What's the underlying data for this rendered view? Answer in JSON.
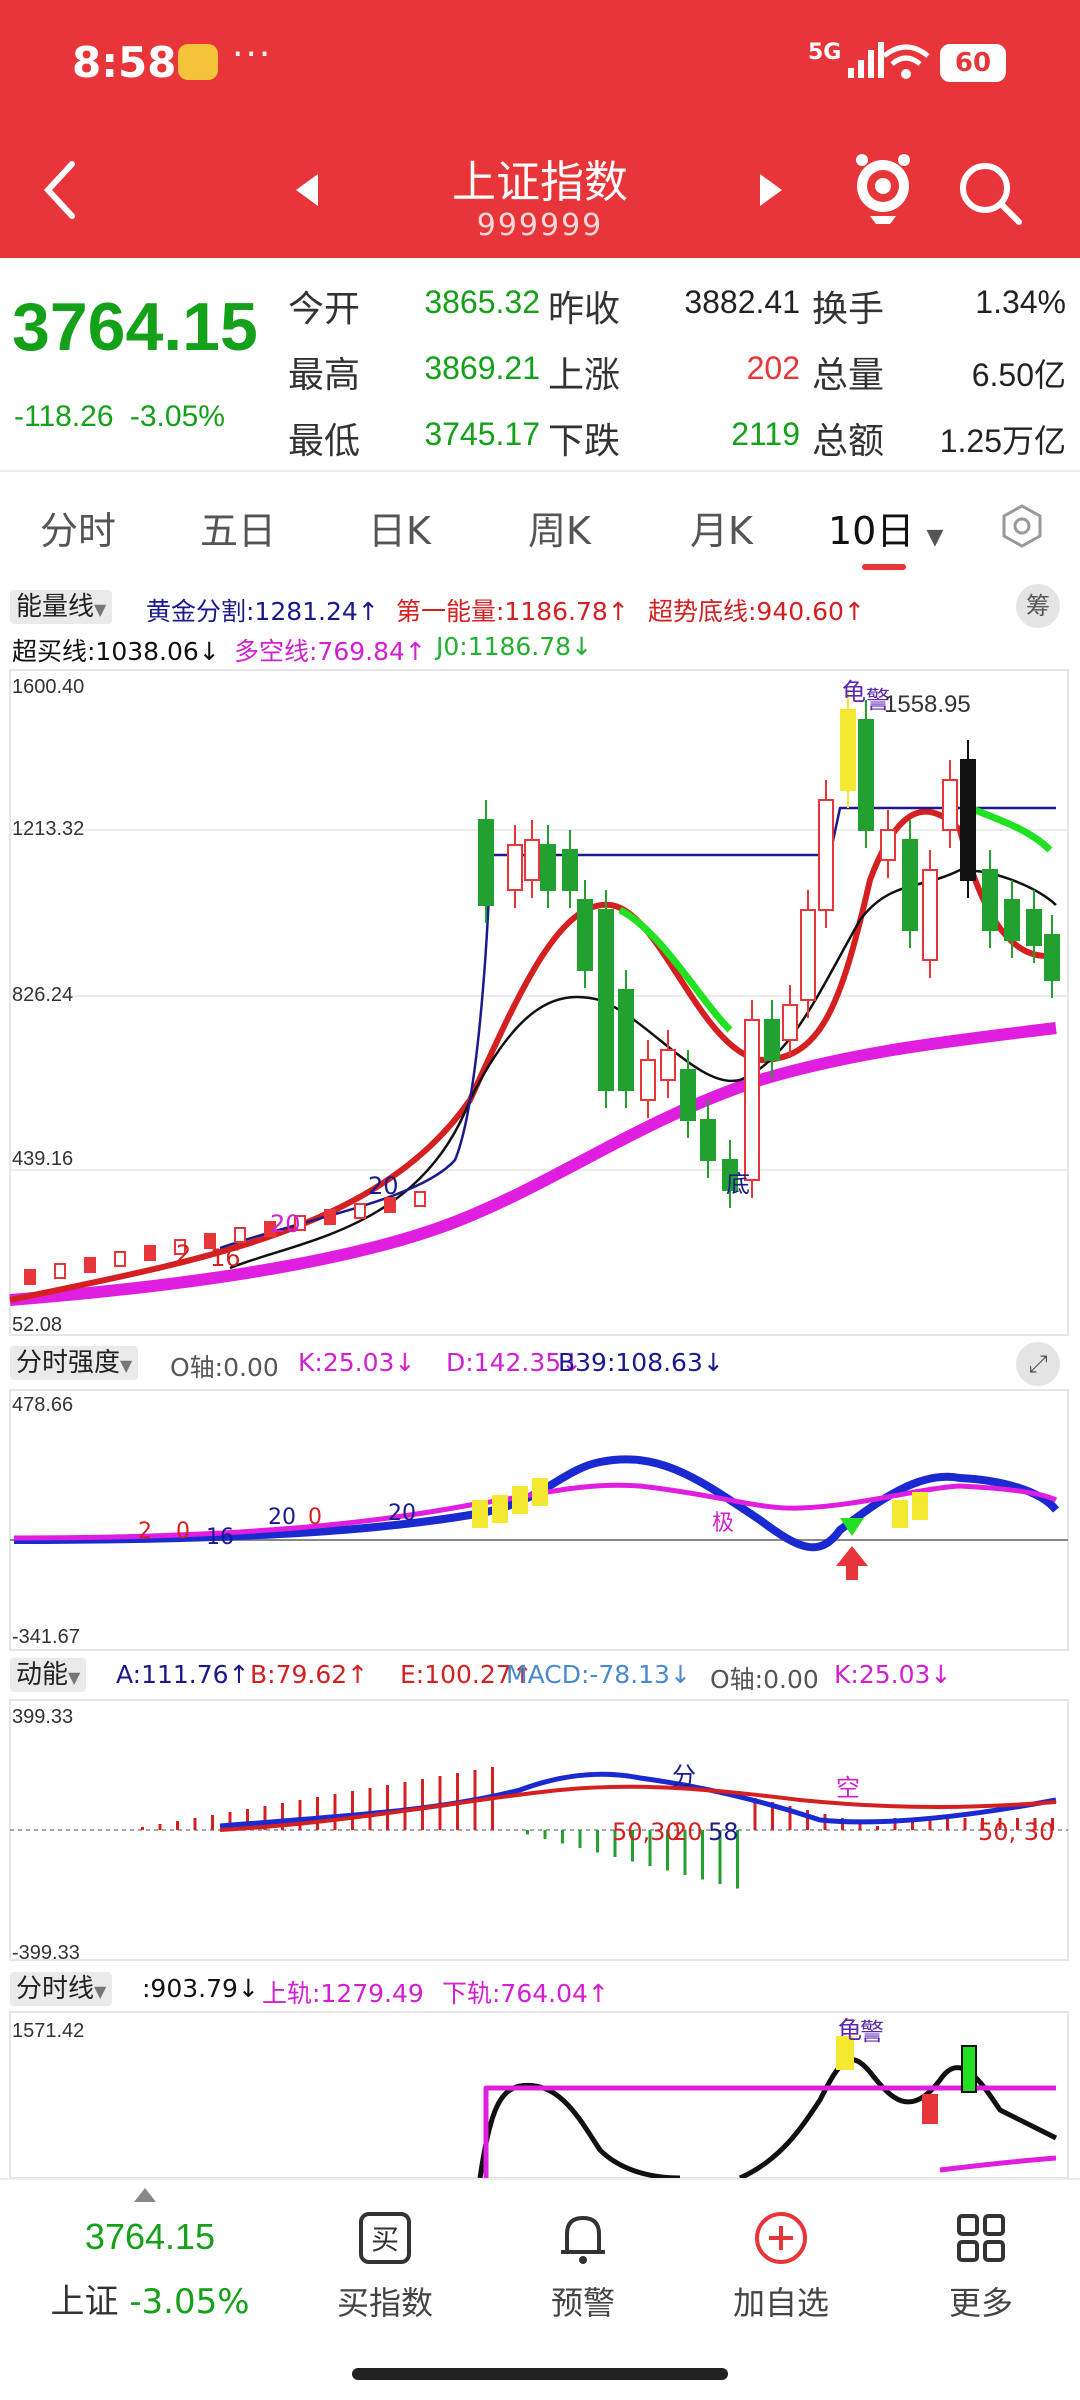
{
  "status_bar": {
    "time": "8:58",
    "dots": "···",
    "network": "5G",
    "battery": "60"
  },
  "header": {
    "title": "上证指数",
    "code": "999999"
  },
  "quote": {
    "price": "3764.15",
    "change": "-118.26",
    "change_pct": "-3.05%",
    "rows": [
      {
        "l1": "今开",
        "v1": "3865.32",
        "c1": "#14a018",
        "l2": "昨收",
        "v2": "3882.41",
        "c2": "#222222",
        "l3": "换手",
        "v3": "1.34%",
        "c3": "#222222"
      },
      {
        "l1": "最高",
        "v1": "3869.21",
        "c1": "#14a018",
        "l2": "上涨",
        "v2": "202",
        "c2": "#e8353a",
        "l3": "总量",
        "v3": "6.50亿",
        "c3": "#222222"
      },
      {
        "l1": "最低",
        "v1": "3745.17",
        "c1": "#14a018",
        "l2": "下跌",
        "v2": "2119",
        "c2": "#14a018",
        "l3": "总额",
        "v3": "1.25万亿",
        "c3": "#222222"
      }
    ]
  },
  "tabs": [
    "分时",
    "五日",
    "日K",
    "周K",
    "月K",
    "10日"
  ],
  "panels": {
    "energy": {
      "name": "能量线",
      "line1": [
        {
          "text": "黄金分割:1281.24↑",
          "color": "#1a1a8c"
        },
        {
          "text": "第一能量:1186.78↑",
          "color": "#d42020"
        },
        {
          "text": "超势底线:940.60↑",
          "color": "#d42020"
        }
      ],
      "line2": [
        {
          "text": "超买线:1038.06↓",
          "color": "#111111"
        },
        {
          "text": "多空线:769.84↑",
          "color": "#d21fd2"
        },
        {
          "text": "J0:1186.78↓",
          "color": "#22b030"
        }
      ],
      "axis": [
        "1600.40",
        "1213.32",
        "826.24",
        "439.16",
        "52.08"
      ],
      "peak_label": "1558.95",
      "chip_btn": "筹",
      "annotations": {
        "top": "龟",
        "top2": "警",
        "mid": "底",
        "left1": "20",
        "left2": "20",
        "left3": "2",
        "left4": "16"
      }
    },
    "strength": {
      "name": "分时强度",
      "items": [
        {
          "text": "O轴:0.00",
          "color": "#555555"
        },
        {
          "text": "K:25.03↓",
          "color": "#d21fd2"
        },
        {
          "text": "D:142.35↓",
          "color": "#d21fd2"
        },
        {
          "text": "B39:108.63↓",
          "color": "#1a1a8c"
        }
      ],
      "axis": [
        "478.66",
        "-341.67"
      ],
      "labels": {
        "a": "2",
        "b": "0",
        "c": "16",
        "d": "20",
        "e": "0",
        "f": "20",
        "g": "极"
      }
    },
    "momentum": {
      "name": "动能",
      "items": [
        {
          "text": "A:111.76↑",
          "color": "#1a1a8c"
        },
        {
          "text": "B:79.62↑",
          "color": "#d42020"
        },
        {
          "text": "E:100.27↑",
          "color": "#d42020"
        },
        {
          "text": "MACD:-78.13↓",
          "color": "#4a8ad0"
        },
        {
          "text": "O轴:0.00",
          "color": "#555555"
        },
        {
          "text": "K:25.03↓",
          "color": "#d21fd2"
        }
      ],
      "axis": [
        "399.33",
        "-399.33"
      ],
      "labels": {
        "a": "分",
        "b": "空",
        "c": "50,30",
        "d": "20",
        "e": "58",
        "f": "50, 30"
      }
    },
    "intraday": {
      "name": "分时线",
      "items": [
        {
          "text": ":903.79↓",
          "color": "#111111"
        },
        {
          "text": "上轨:1279.49",
          "color": "#d21fd2"
        },
        {
          "text": "下轨:764.04↑",
          "color": "#d21fd2"
        }
      ],
      "axis": [
        "1571.42"
      ],
      "labels": {
        "a": "龟",
        "b": "警"
      }
    }
  },
  "bottom_nav": {
    "price": "3764.15",
    "index_name": "上证",
    "index_change": "-3.05%",
    "items": [
      {
        "label": "买指数",
        "icon": "buy-icon"
      },
      {
        "label": "预警",
        "icon": "bell-icon"
      },
      {
        "label": "加自选",
        "icon": "add-watchlist-icon"
      },
      {
        "label": "更多",
        "icon": "more-grid-icon"
      }
    ],
    "buy_glyph": "买"
  },
  "colors": {
    "header": "#e8353a",
    "up": "#e8353a",
    "down": "#14a018",
    "magenta": "#e01ee0"
  }
}
